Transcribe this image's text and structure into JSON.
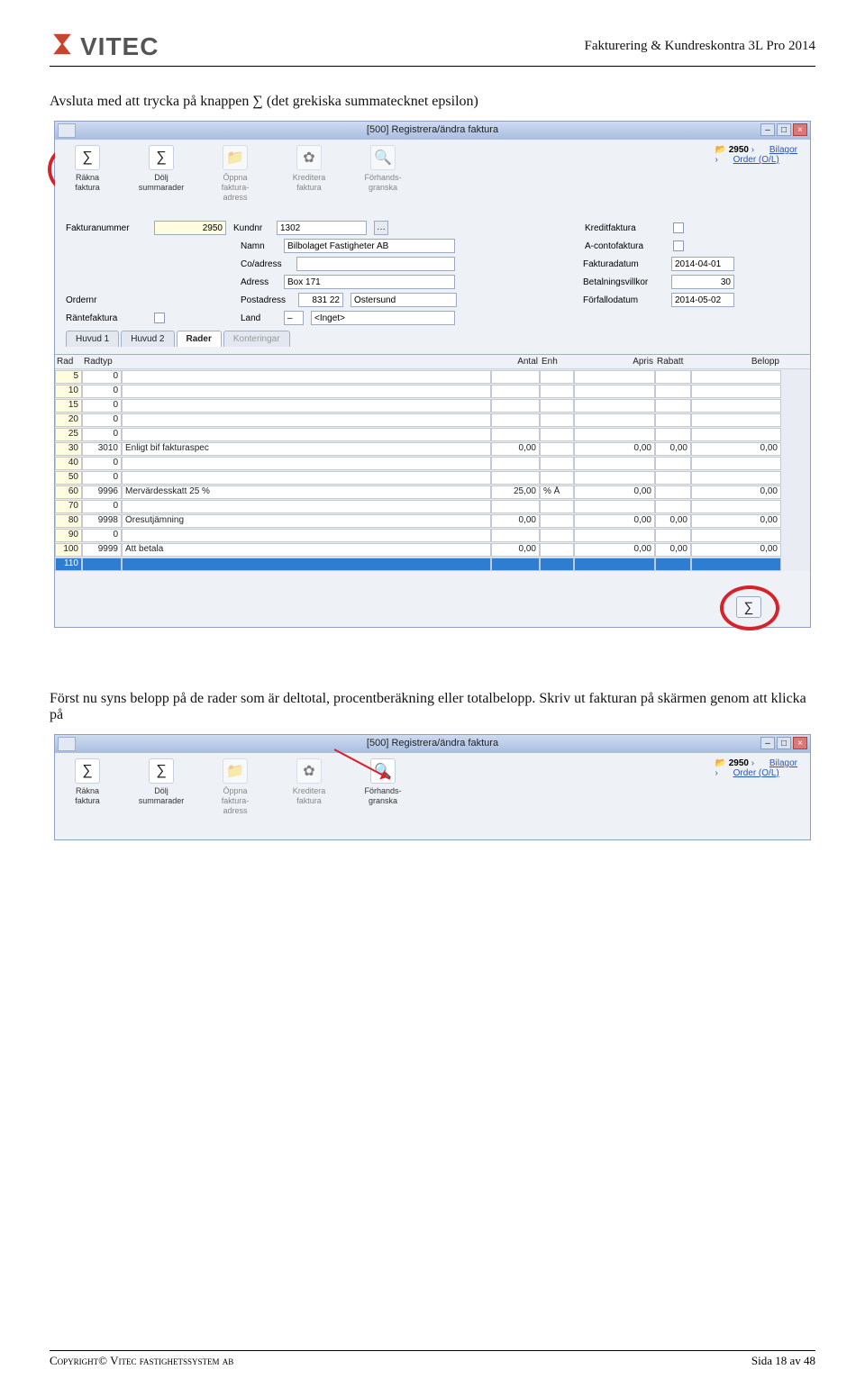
{
  "doc": {
    "header_title": "Fakturering & Kundreskontra 3L Pro 2014",
    "logo_text": "VITEC",
    "intro_text": "Avsluta med att trycka på knappen ∑ (det grekiska summatecknet epsilon)",
    "mid_text": "Först nu syns belopp på de rader som är deltotal, procentberäkning eller totalbelopp. Skriv ut fakturan på skärmen genom att klicka på",
    "footer_left": "Copyright© Vitec fastighetssystem ab",
    "footer_right": "Sida 18 av 48"
  },
  "win": {
    "title": "[500]  Registrera/ändra faktura",
    "toolbar": [
      {
        "label": "Räkna\nfaktura",
        "icon": "∑",
        "dim": false
      },
      {
        "label": "Dölj\nsummarader",
        "icon": "∑",
        "dim": false
      },
      {
        "label": "Öppna\nfaktura-\nadress",
        "icon": "📁",
        "dim": true
      },
      {
        "label": "Kreditera\nfaktura",
        "icon": "✿",
        "dim": true
      },
      {
        "label": "Förhands-\ngranska",
        "icon": "🔍",
        "dim": true
      }
    ],
    "links": {
      "head": "2950",
      "a": "Bilagor",
      "b": "Order (O/L)"
    },
    "form": {
      "fakturanummer_lbl": "Fakturanummer",
      "fakturanummer": "2950",
      "kundnr_lbl": "Kundnr",
      "kundnr": "1302",
      "namn_lbl": "Namn",
      "namn": "Bilbolaget Fastigheter AB",
      "co_lbl": "Co/adress",
      "co": "",
      "adress_lbl": "Adress",
      "adress": "Box 171",
      "postadress_lbl": "Postadress",
      "post_nr": "831 22",
      "post_ort": "Östersund",
      "ordernr_lbl": "Ordernr",
      "rantefaktura_lbl": "Räntefaktura",
      "land_lbl": "Land",
      "land_code": "–",
      "land_sel": "<Inget>",
      "kreditfaktura_lbl": "Kreditfaktura",
      "aconto_lbl": "A-contofaktura",
      "fakturadatum_lbl": "Fakturadatum",
      "fakturadatum": "2014-04-01",
      "betal_lbl": "Betalningsvillkor",
      "betal": "30",
      "forfallo_lbl": "Förfallodatum",
      "forfallo": "2014-05-02"
    },
    "tabs": {
      "t1": "Huvud 1",
      "t2": "Huvud 2",
      "t3": "Rader",
      "t4": "Konteringar"
    },
    "grid_head": {
      "rad": "Rad",
      "radtyp": "Radtyp",
      "antal": "Antal",
      "enh": "Enh",
      "apris": "Apris",
      "rabatt": "Rabatt",
      "belopp": "Belopp"
    },
    "rows": [
      {
        "rad": "5",
        "typ": "0",
        "desc": "",
        "antal": "",
        "enh": "",
        "apris": "",
        "rabatt": "",
        "belopp": ""
      },
      {
        "rad": "10",
        "typ": "0",
        "desc": "",
        "antal": "",
        "enh": "",
        "apris": "",
        "rabatt": "",
        "belopp": ""
      },
      {
        "rad": "15",
        "typ": "0",
        "desc": "",
        "antal": "",
        "enh": "",
        "apris": "",
        "rabatt": "",
        "belopp": ""
      },
      {
        "rad": "20",
        "typ": "0",
        "desc": "",
        "antal": "",
        "enh": "",
        "apris": "",
        "rabatt": "",
        "belopp": ""
      },
      {
        "rad": "25",
        "typ": "0",
        "desc": "",
        "antal": "",
        "enh": "",
        "apris": "",
        "rabatt": "",
        "belopp": ""
      },
      {
        "rad": "30",
        "typ": "3010",
        "desc": "Enligt bif fakturaspec",
        "antal": "0,00",
        "enh": "",
        "apris": "0,00",
        "rabatt": "0,00",
        "belopp": "0,00"
      },
      {
        "rad": "40",
        "typ": "0",
        "desc": "",
        "antal": "",
        "enh": "",
        "apris": "",
        "rabatt": "",
        "belopp": ""
      },
      {
        "rad": "50",
        "typ": "0",
        "desc": "",
        "antal": "",
        "enh": "",
        "apris": "",
        "rabatt": "",
        "belopp": ""
      },
      {
        "rad": "60",
        "typ": "9996",
        "desc": "Mervärdesskatt 25 %",
        "antal": "25,00",
        "enh": "% Å",
        "apris": "0,00",
        "rabatt": "",
        "belopp": "0,00"
      },
      {
        "rad": "70",
        "typ": "0",
        "desc": "",
        "antal": "",
        "enh": "",
        "apris": "",
        "rabatt": "",
        "belopp": ""
      },
      {
        "rad": "80",
        "typ": "9998",
        "desc": "Öresutjämning",
        "antal": "0,00",
        "enh": "",
        "apris": "0,00",
        "rabatt": "0,00",
        "belopp": "0,00"
      },
      {
        "rad": "90",
        "typ": "0",
        "desc": "",
        "antal": "",
        "enh": "",
        "apris": "",
        "rabatt": "",
        "belopp": ""
      },
      {
        "rad": "100",
        "typ": "9999",
        "desc": "Att betala",
        "antal": "0,00",
        "enh": "",
        "apris": "0,00",
        "rabatt": "0,00",
        "belopp": "0,00"
      },
      {
        "rad": "110",
        "typ": "",
        "desc": "",
        "antal": "",
        "enh": "",
        "apris": "",
        "rabatt": "",
        "belopp": "",
        "selected": true
      }
    ]
  },
  "win2": {
    "title": "[500]  Registrera/ändra faktura",
    "toolbar": [
      {
        "label": "Räkna\nfaktura",
        "icon": "∑",
        "dim": false
      },
      {
        "label": "Dölj\nsummarader",
        "icon": "∑",
        "dim": false
      },
      {
        "label": "Öppna\nfaktura-\nadress",
        "icon": "📁",
        "dim": true
      },
      {
        "label": "Kreditera\nfaktura",
        "icon": "✿",
        "dim": true
      },
      {
        "label": "Förhands-\ngranska",
        "icon": "🔍",
        "dim": false
      }
    ],
    "links": {
      "head": "2950",
      "a": "Bilagor",
      "b": "Order (O/L)"
    }
  }
}
